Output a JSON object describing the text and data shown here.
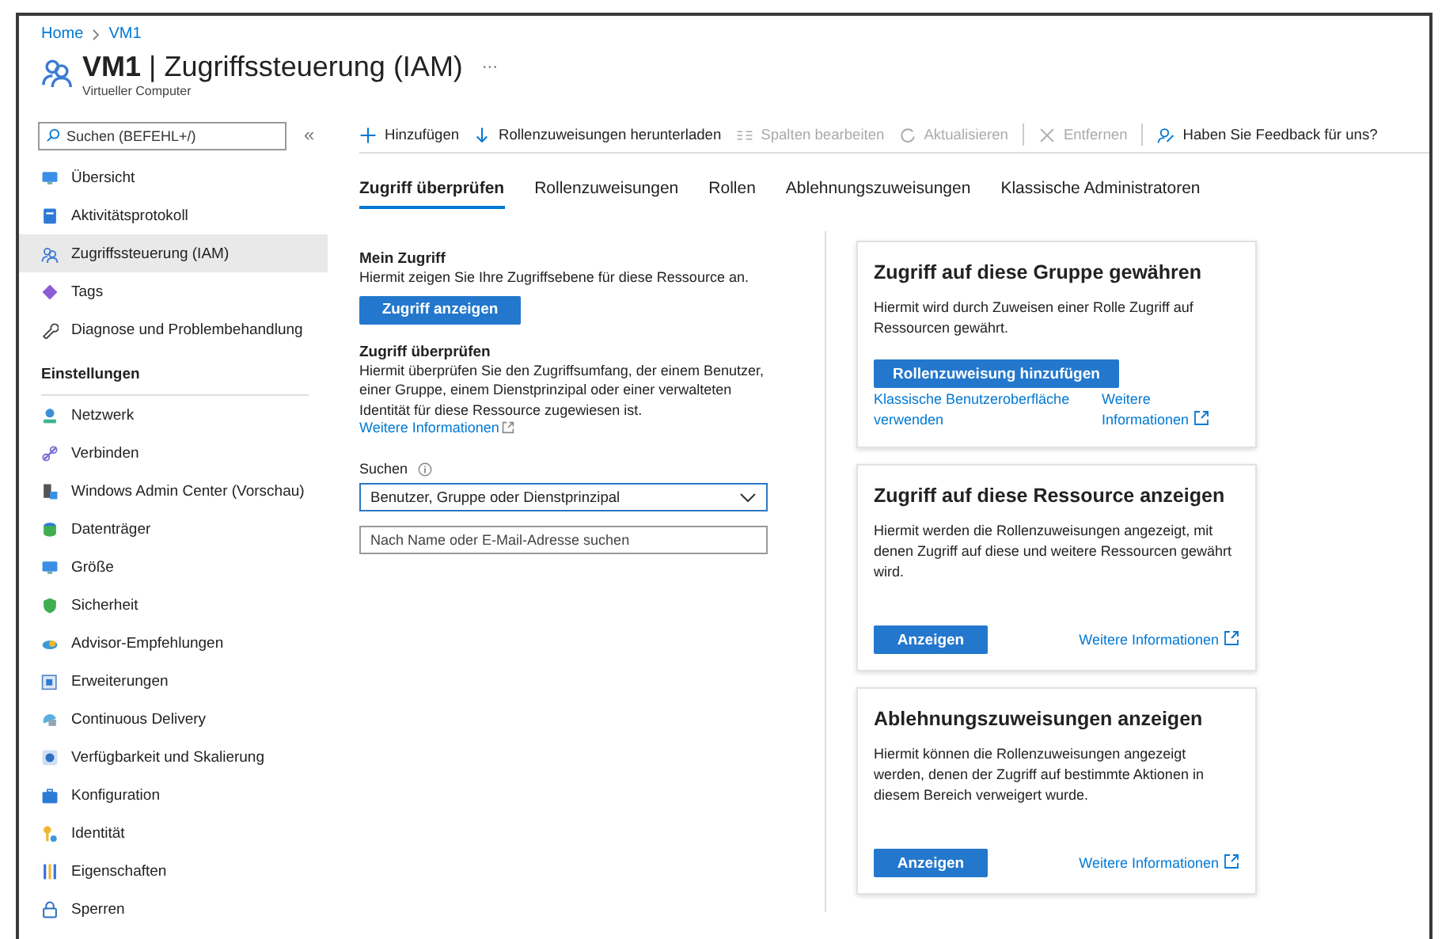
{
  "breadcrumb": [
    {
      "label": "Home"
    },
    {
      "label": "VM1"
    }
  ],
  "header": {
    "title": "**VM1** | Zugriffssteuerung (IAM)",
    "more": "···",
    "subtitle": "Virtueller Computer"
  },
  "sidebar": {
    "search": {
      "placeholder": "Suchen (BEFEHL+/)"
    },
    "collapse": "«",
    "items": [
      {
        "kind": "item",
        "label": "Übersicht",
        "selected": false
      },
      {
        "kind": "item",
        "label": "Aktivitätsprotokoll",
        "selected": false
      },
      {
        "kind": "item",
        "label": "Zugriffssteuerung (IAM)",
        "selected": true
      },
      {
        "kind": "item",
        "label": "Tags",
        "selected": false
      },
      {
        "kind": "item",
        "label": "Diagnose und Problembehandlung",
        "selected": false
      },
      {
        "kind": "heading",
        "label": "Einstellungen"
      },
      {
        "kind": "item",
        "label": "Netzwerk",
        "selected": false
      },
      {
        "kind": "item",
        "label": "Verbinden",
        "selected": false
      },
      {
        "kind": "item",
        "label": "Windows Admin Center (Vorschau)",
        "selected": false
      },
      {
        "kind": "item",
        "label": "Datenträger",
        "selected": false
      },
      {
        "kind": "item",
        "label": "Größe",
        "selected": false
      },
      {
        "kind": "item",
        "label": "Sicherheit",
        "selected": false
      },
      {
        "kind": "item",
        "label": "Advisor-Empfehlungen",
        "selected": false
      },
      {
        "kind": "item",
        "label": "Erweiterungen",
        "selected": false
      },
      {
        "kind": "item",
        "label": "Continuous Delivery",
        "selected": false
      },
      {
        "kind": "item",
        "label": "Verfügbarkeit und Skalierung",
        "selected": false
      },
      {
        "kind": "item",
        "label": "Konfiguration",
        "selected": false
      },
      {
        "kind": "item",
        "label": "Identität",
        "selected": false
      },
      {
        "kind": "item",
        "label": "Eigenschaften",
        "selected": false
      },
      {
        "kind": "item",
        "label": "Sperren",
        "selected": false
      }
    ]
  },
  "toolbar": [
    {
      "label": "Hinzufügen",
      "disabled": false
    },
    {
      "label": "Rollenzuweisungen herunterladen",
      "disabled": false
    },
    {
      "label": "Spalten bearbeiten",
      "disabled": true
    },
    {
      "label": "Aktualisieren",
      "disabled": true
    },
    {
      "label": "Entfernen",
      "disabled": true
    },
    {
      "label": "Haben Sie Feedback für uns?",
      "disabled": false
    }
  ],
  "tabs": [
    {
      "label": "Zugriff überprüfen",
      "selected": true
    },
    {
      "label": "Rollenzuweisungen",
      "selected": false
    },
    {
      "label": "Rollen",
      "selected": false
    },
    {
      "label": "Ablehnungszuweisungen",
      "selected": false
    },
    {
      "label": "Klassische Administratoren",
      "selected": false
    }
  ],
  "my_access": {
    "title": "Mein Zugriff",
    "text": "Hiermit zeigen Sie Ihre Zugriffsebene für diese Ressource an.",
    "button": "Zugriff anzeigen"
  },
  "check_access": {
    "title": "Zugriff überprüfen",
    "text": "Hiermit überprüfen Sie den Zugriffsumfang, der einem Benutzer, einer Gruppe, einem Dienstprinzipal oder einer verwalteten Identität für diese Ressource zugewiesen ist.",
    "link": "Weitere Informationen",
    "search_label": "Suchen",
    "select": {
      "value": "Benutzer, Gruppe oder Dienstprinzipal"
    },
    "input": {
      "placeholder": "Nach Name oder E-Mail-Adresse suchen"
    }
  },
  "cards": [
    {
      "kind": "stacked",
      "title": "Zugriff auf diese Gruppe gewähren",
      "text": "Hiermit wird durch Zuweisen einer Rolle Zugriff auf Ressourcen gewährt.",
      "button": "Rollenzuweisung hinzufügen",
      "links": [
        {
          "label": "Klassische Benutzeroberfläche verwenden",
          "external": false
        },
        {
          "label": "Weitere Informationen",
          "external": true
        }
      ]
    },
    {
      "kind": "inline",
      "title": "Zugriff auf diese Ressource anzeigen",
      "text": "Hiermit werden die Rollenzuweisungen angezeigt, mit denen Zugriff auf diese und weitere Ressourcen gewährt wird.",
      "button": "Anzeigen",
      "links": [
        {
          "label": "Weitere Informationen",
          "external": true
        }
      ]
    },
    {
      "kind": "inline",
      "title": "Ablehnungszuweisungen anzeigen",
      "text": "Hiermit können die Rollenzuweisungen angezeigt werden, denen der Zugriff auf bestimmte Aktionen in diesem Bereich verweigert wurde.",
      "button": "Anzeigen",
      "links": [
        {
          "label": "Weitere Informationen",
          "external": true
        }
      ]
    }
  ]
}
